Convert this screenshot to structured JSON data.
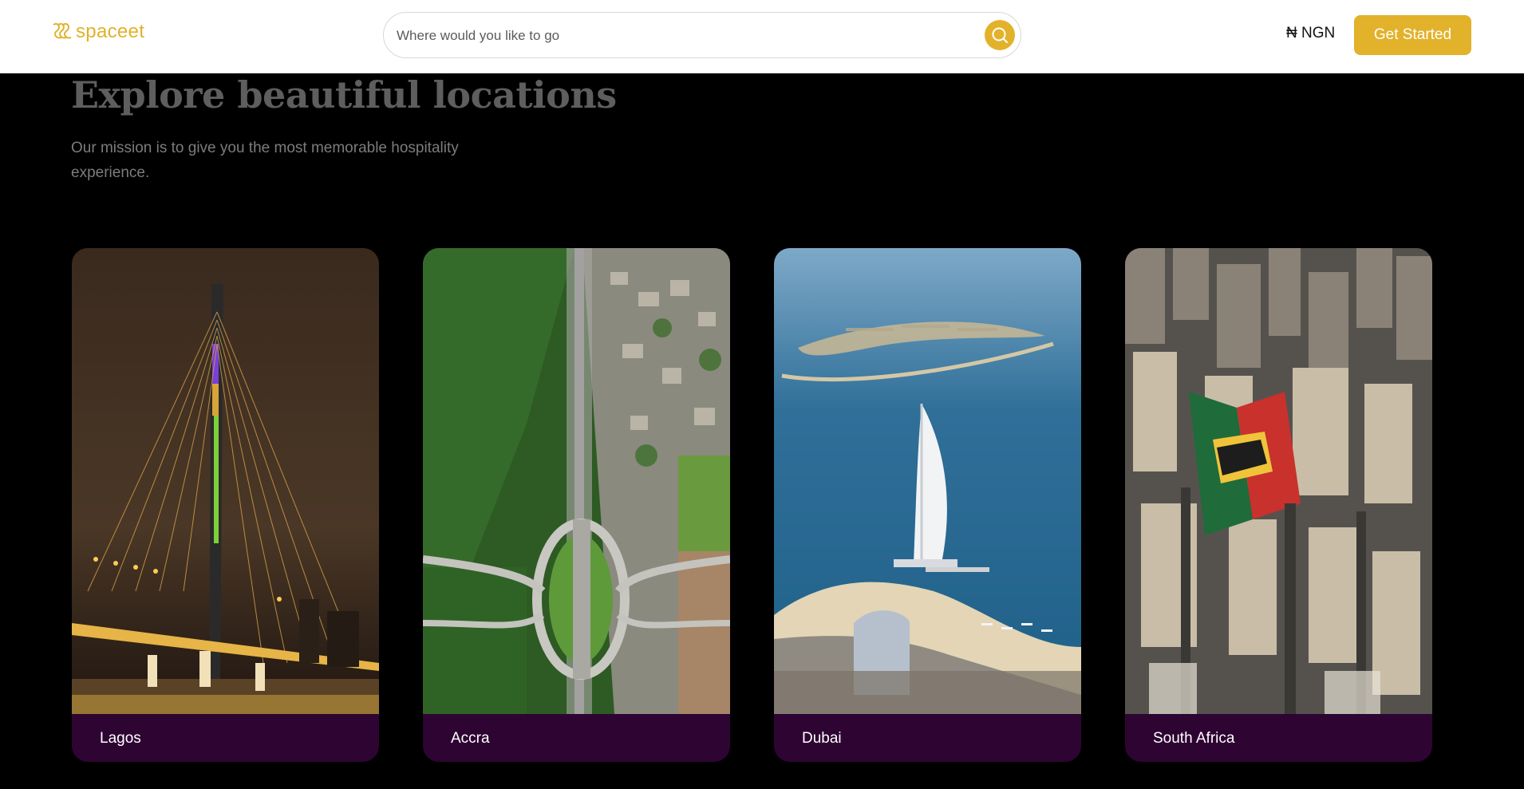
{
  "brand": {
    "name": "spaceet",
    "color": "#e0b22b"
  },
  "search": {
    "placeholder": "Where would you like to go",
    "value": "",
    "icon": "search-icon"
  },
  "currency": {
    "label": "₦ NGN"
  },
  "header": {
    "cta_label": "Get Started",
    "accent": "#e2b22b"
  },
  "hero": {
    "title": "Explore beautiful locations",
    "subtitle": "Our mission is to give you the most memorable hospitality experience."
  },
  "locations": [
    {
      "name": "Lagos"
    },
    {
      "name": "Accra"
    },
    {
      "name": "Dubai"
    },
    {
      "name": "South Africa"
    }
  ],
  "colors": {
    "card_label_bg": "#2e0433",
    "page_bg": "#000000"
  }
}
